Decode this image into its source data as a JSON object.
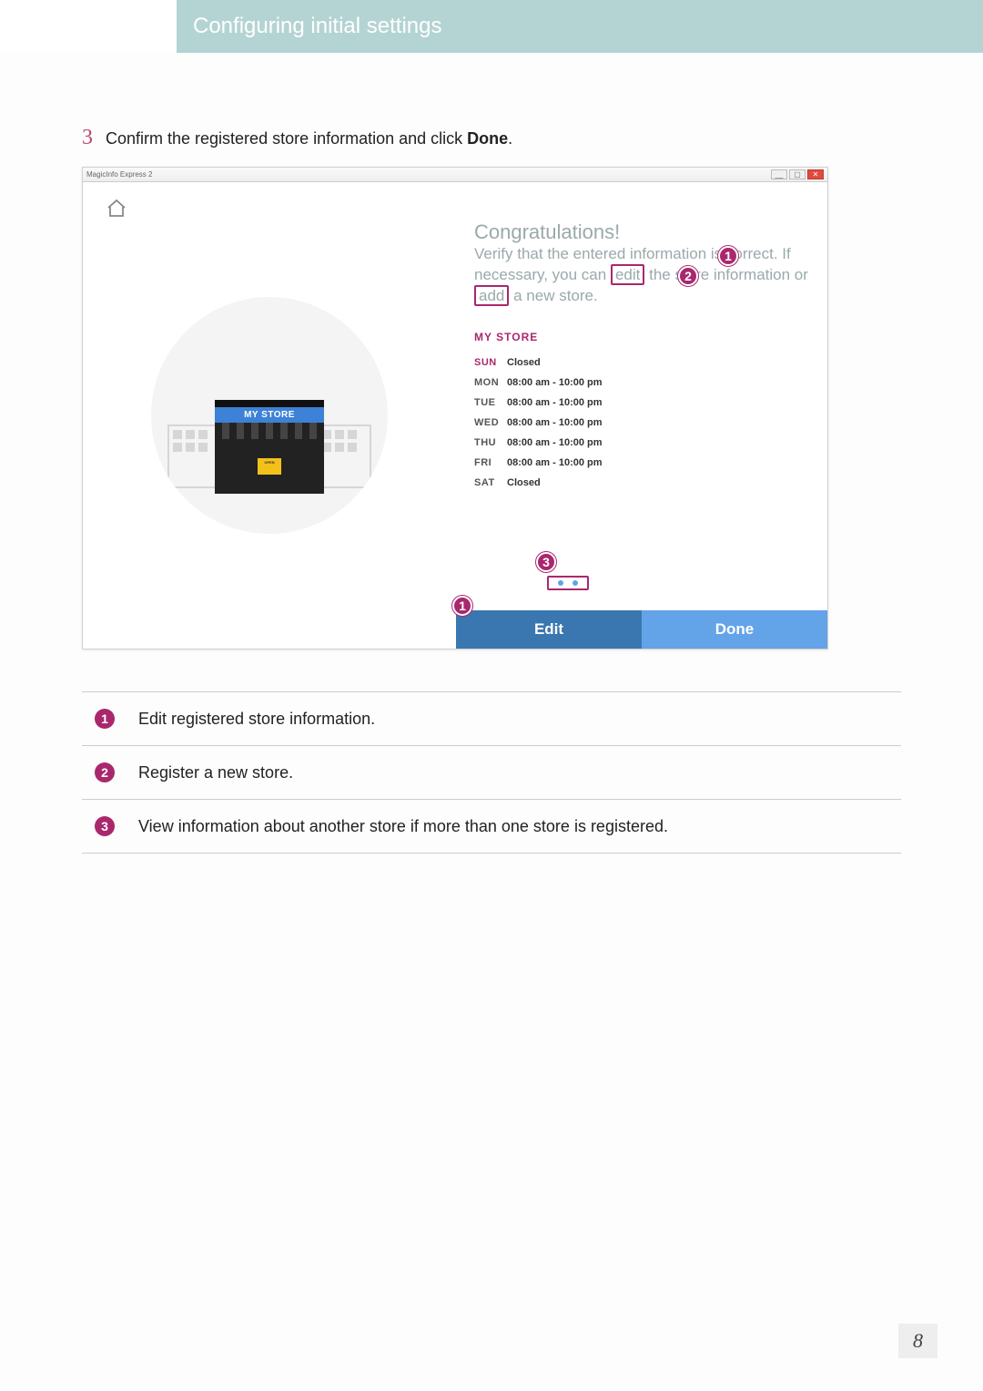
{
  "chapter_title": "Configuring initial settings",
  "step": {
    "number": "3",
    "text_before": "Confirm the registered store information and click ",
    "bold": "Done",
    "text_after": "."
  },
  "window": {
    "title": "MagicInfo Express 2",
    "min": "__",
    "max": "▢",
    "close": "✕"
  },
  "panel": {
    "congrats_heading": "Congratulations!",
    "congrats_line": "Verify that the entered information is correct. If necessary, you can",
    "edit_word": "edit",
    "middle": "the store information or",
    "add_word": "add",
    "tail": "a new store.",
    "store_sign": "MY STORE",
    "open_sign": "OPEN",
    "store_heading": "My Store",
    "hours": [
      {
        "day": "SUN",
        "hours": "Closed",
        "weekend": true
      },
      {
        "day": "MON",
        "hours": "08:00 am - 10:00 pm",
        "weekend": false
      },
      {
        "day": "TUE",
        "hours": "08:00 am - 10:00 pm",
        "weekend": false
      },
      {
        "day": "WED",
        "hours": "08:00 am - 10:00 pm",
        "weekend": false
      },
      {
        "day": "THU",
        "hours": "08:00 am - 10:00 pm",
        "weekend": false
      },
      {
        "day": "FRI",
        "hours": "08:00 am - 10:00 pm",
        "weekend": false
      },
      {
        "day": "SAT",
        "hours": "Closed",
        "weekend": false
      }
    ],
    "edit_button": "Edit",
    "done_button": "Done"
  },
  "callouts": {
    "c1": "1",
    "c2": "2",
    "c3": "3"
  },
  "legend": [
    {
      "n": "1",
      "text": "Edit registered store information."
    },
    {
      "n": "2",
      "text": "Register a new store."
    },
    {
      "n": "3",
      "text": "View information about another store if more than one store is registered."
    }
  ],
  "page_number": "8"
}
